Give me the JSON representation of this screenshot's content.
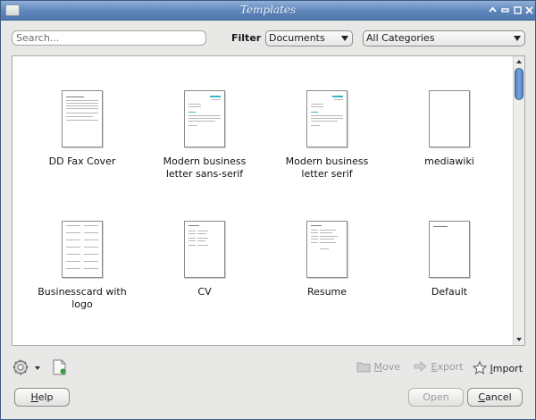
{
  "window": {
    "title": "Templates"
  },
  "search": {
    "placeholder": "Search..."
  },
  "filter": {
    "label": "Filter",
    "type_selected": "Documents",
    "category_selected": "All Categories"
  },
  "templates": [
    {
      "label_line1": "DD Fax Cover",
      "label_line2": ""
    },
    {
      "label_line1": "Modern business",
      "label_line2": "letter sans-serif"
    },
    {
      "label_line1": "Modern business",
      "label_line2": "letter serif"
    },
    {
      "label_line1": "mediawiki",
      "label_line2": ""
    },
    {
      "label_line1": "Businesscard with",
      "label_line2": "logo"
    },
    {
      "label_line1": "CV",
      "label_line2": ""
    },
    {
      "label_line1": "Resume",
      "label_line2": ""
    },
    {
      "label_line1": "Default",
      "label_line2": ""
    }
  ],
  "toolbar": {
    "move_first": "M",
    "move_rest": "ove",
    "export_first": "E",
    "export_rest": "xport",
    "import_first": "I",
    "import_rest": "mport"
  },
  "buttons": {
    "help_first": "H",
    "help_rest": "elp",
    "open": "Open",
    "cancel_first": "C",
    "cancel_rest": "ancel"
  },
  "colors": {
    "accent": "#5f86ba",
    "teal": "#39b3c7"
  },
  "icons": [
    "restore-icon",
    "minimize-icon",
    "maximize-icon",
    "close-icon",
    "gear-icon",
    "new-document-icon",
    "folder-icon",
    "export-arrow-icon",
    "star-icon"
  ]
}
